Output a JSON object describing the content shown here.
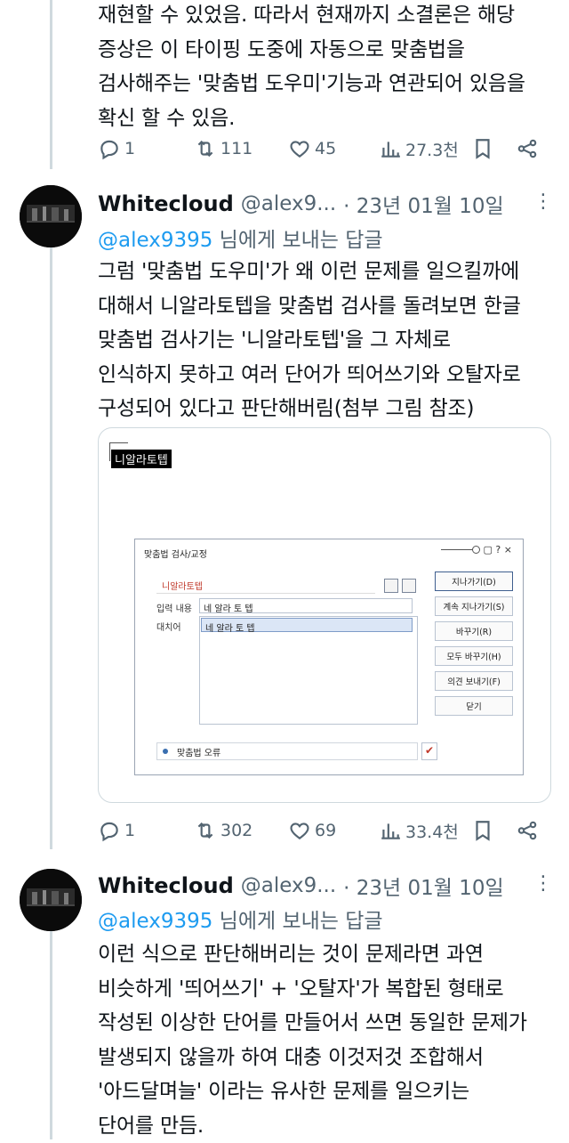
{
  "tweet1": {
    "body_lines": [
      "재현할 수 있었음. 따라서 현재까지 소결론은 해당",
      "증상은 이 타이핑 도중에 자동으로 맞춤법을",
      "검사해주는 '맞춤법 도우미'기능과 연관되어 있음을",
      "확신 할 수 있음."
    ],
    "metrics": {
      "replies": "1",
      "reposts": "111",
      "likes": "45",
      "views": "27.3천"
    }
  },
  "tweet2": {
    "display_name": "Whitecloud",
    "handle": "@alex9...",
    "date": "· 23년 01월 10일",
    "reply_to_handle": "@alex9395",
    "reply_to_suffix": " 님에게 보내는 답글",
    "body_lines": [
      "그럼 '맞춤법 도우미'가 왜 이런 문제를 일으킬까에",
      "대해서 니알라토텝을 맞춤법 검사를 돌려보면 한글",
      "맞춤법 검사기는 '니알라토텝'을 그 자체로",
      "인식하지 못하고 여러 단어가 띄어쓰기와 오탈자로",
      "구성되어 있다고 판단해버림(첨부 그림 참조)"
    ],
    "media": {
      "highlighted_word": "니알라토텝",
      "dialog": {
        "title": "맞춤법 검사/교정",
        "controls": "▢ ? ×",
        "original_word": "니알라토텝",
        "input_label": "입력 내용",
        "input_value": "네 알라 토 텝",
        "replace_label": "대치어",
        "replace_value": "네 알라 토 텝",
        "buttons": [
          "지나가기(D)",
          "계속 지나가기(S)",
          "바꾸기(R)",
          "모두 바꾸기(H)",
          "의견 보내기(F)",
          "닫기"
        ],
        "status_text": "맞춤법 오류"
      }
    },
    "metrics": {
      "replies": "1",
      "reposts": "302",
      "likes": "69",
      "views": "33.4천"
    }
  },
  "tweet3": {
    "display_name": "Whitecloud",
    "handle": "@alex9...",
    "date": "· 23년 01월 10일",
    "reply_to_handle": "@alex9395",
    "reply_to_suffix": " 님에게 보내는 답글",
    "body_lines": [
      "이런 식으로 판단해버리는 것이 문제라면 과연",
      "비슷하게 '띄어쓰기' + '오탈자'가 복합된 형태로",
      "작성된 이상한 단어를 만들어서 쓰면 동일한 문제가",
      "발생되지 않을까 하여 대충 이것저것 조합해서",
      "'아드달며늘' 이라는 유사한 문제를 일으키는",
      "단어를 만듬."
    ]
  }
}
